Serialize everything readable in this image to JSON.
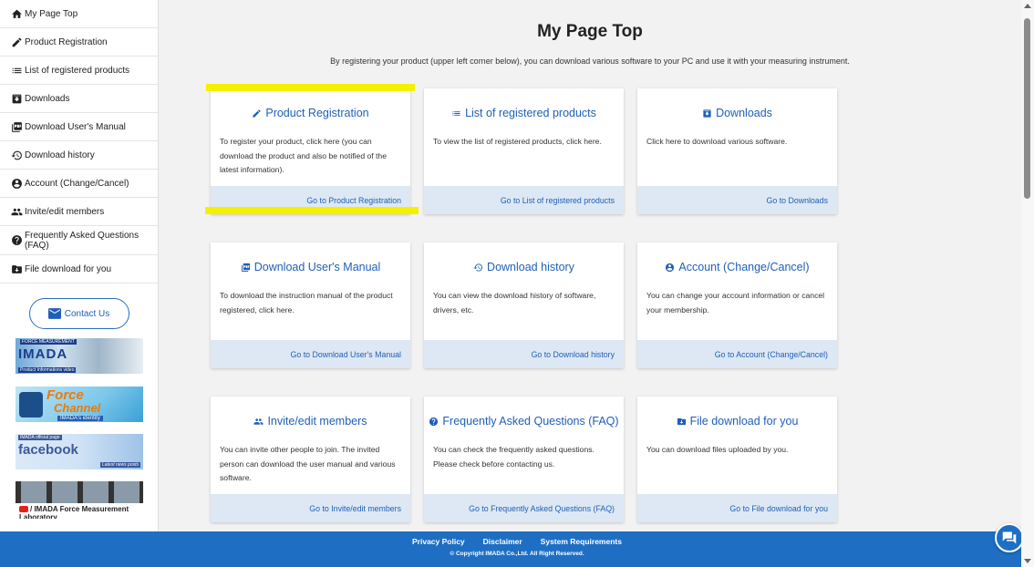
{
  "sidebar": {
    "items": [
      {
        "label": "My Page Top",
        "icon": "home-icon"
      },
      {
        "label": "Product Registration",
        "icon": "pencil-icon"
      },
      {
        "label": "List of registered products",
        "icon": "list-icon"
      },
      {
        "label": "Downloads",
        "icon": "download-box-icon"
      },
      {
        "label": "Download User's Manual",
        "icon": "pdf-icon"
      },
      {
        "label": "Download history",
        "icon": "history-icon"
      },
      {
        "label": "Account (Change/Cancel)",
        "icon": "account-circle-icon"
      },
      {
        "label": "Invite/edit members",
        "icon": "people-icon"
      },
      {
        "label": "Frequently Asked Questions (FAQ)",
        "icon": "help-circle-icon"
      },
      {
        "label": "File download for you",
        "icon": "folder-download-icon"
      }
    ],
    "contact_label": "Contact Us",
    "banners": {
      "imada_top": "FORCE MEASUREMENT",
      "imada_logo": "IMADA",
      "imada_sub": "Product Informations video",
      "force_1": "Force",
      "force_2": "Channel",
      "force_sub": "IMADA's identity",
      "fb_top": "IMADA official page",
      "fb_logo": "facebook",
      "fb_sub": "Latest news posts",
      "yt_label": "/ IMADA Force Measurement Laboratory"
    }
  },
  "main": {
    "title": "My Page Top",
    "description": "By registering your product (upper left corner below), you can download various software to your PC and use it with your measuring instrument.",
    "cards": [
      {
        "title": "Product Registration",
        "icon": "pencil-icon",
        "desc": "To register your product, click here (you can download the product and also be notified of the latest information).",
        "link": "Go to Product Registration"
      },
      {
        "title": "List of registered products",
        "icon": "list-icon",
        "desc": "To view the list of registered products, click here.",
        "link": "Go to List of registered products"
      },
      {
        "title": "Downloads",
        "icon": "download-box-icon",
        "desc": "Click here to download various software.",
        "link": "Go to Downloads"
      },
      {
        "title": "Download User's Manual",
        "icon": "pdf-icon",
        "desc": "To download the instruction manual of the product registered, click here.",
        "link": "Go to Download User's Manual"
      },
      {
        "title": "Download history",
        "icon": "history-icon",
        "desc": "You can view the download history of software, drivers, etc.",
        "link": "Go to Download history"
      },
      {
        "title": "Account (Change/Cancel)",
        "icon": "account-circle-icon",
        "desc": "You can change your account information or cancel your membership.",
        "link": "Go to Account (Change/Cancel)"
      },
      {
        "title": "Invite/edit members",
        "icon": "people-icon",
        "desc": "You can invite other people to join. The invited person can download the user manual and various software.",
        "link": "Go to Invite/edit members"
      },
      {
        "title": "Frequently Asked Questions (FAQ)",
        "icon": "help-circle-icon",
        "desc": "You can check the frequently asked questions. Please check before contacting us.",
        "link": "Go to Frequently Asked Questions (FAQ)"
      },
      {
        "title": "File download for you",
        "icon": "folder-download-icon",
        "desc": "You can download files uploaded by you.",
        "link": "Go to File download for you"
      }
    ]
  },
  "footer": {
    "links": [
      "Privacy Policy",
      "Disclaimer",
      "System Requirements"
    ],
    "copyright": "© Copyright IMADA Co.,Ltd. All Right Reserved."
  },
  "colors": {
    "accent": "#1f5fb8",
    "footer_bg": "#1e6fc4",
    "card_footer_bg": "#dde8f4",
    "highlight": "#f5f000"
  }
}
